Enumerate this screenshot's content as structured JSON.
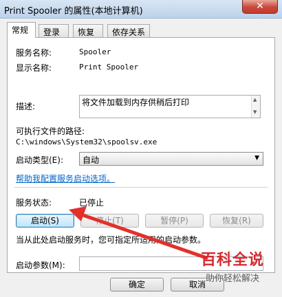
{
  "window": {
    "title": "Print Spooler 的属性(本地计算机)",
    "close_glyph": "✕"
  },
  "tabs": [
    {
      "label": "常规",
      "active": true
    },
    {
      "label": "登录",
      "active": false
    },
    {
      "label": "恢复",
      "active": false
    },
    {
      "label": "依存关系",
      "active": false
    }
  ],
  "general": {
    "service_name_label": "服务名称:",
    "service_name": "Spooler",
    "display_name_label": "显示名称:",
    "display_name": "Print Spooler",
    "description_label": "描述:",
    "description": "将文件加载到内存供稍后打印",
    "exe_path_label": "可执行文件的路径:",
    "exe_path": "C:\\windows\\System32\\spoolsv.exe",
    "startup_type_label": "启动类型(E):",
    "startup_type": "自动",
    "help_link": "帮助我配置服务启动选项。",
    "status_label": "服务状态:",
    "status": "已停止",
    "buttons": {
      "start": "启动(S)",
      "stop": "停止(T)",
      "pause": "暂停(P)",
      "resume": "恢复(R)"
    },
    "hint": "当从此处启动服务时，您可指定所适用的启动参数。",
    "params_label": "启动参数(M):",
    "params_value": ""
  },
  "footer": {
    "ok": "确定",
    "cancel": "取消"
  },
  "watermark": {
    "title": "百科全说",
    "subtitle": "助你轻松解决"
  }
}
